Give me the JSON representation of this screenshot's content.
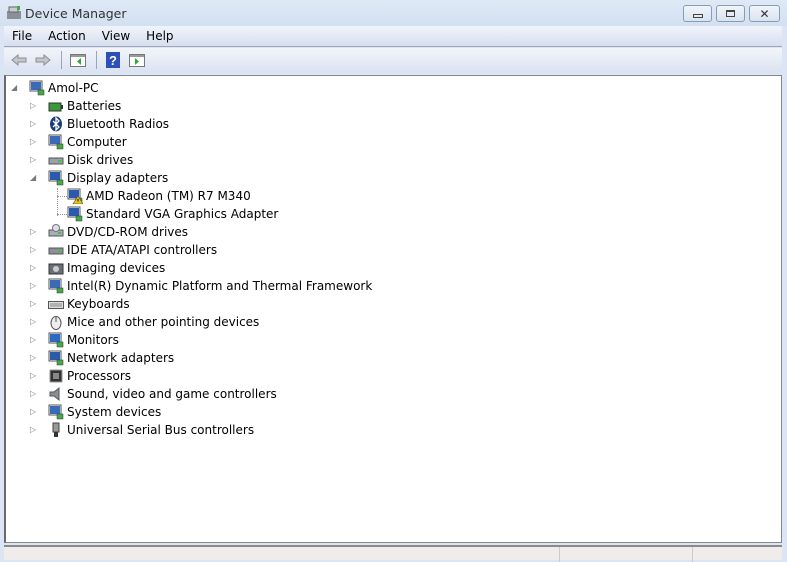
{
  "window": {
    "title": "Device Manager",
    "minimize": "minimize",
    "maximize": "maximize",
    "close": "close"
  },
  "menu": [
    "File",
    "Action",
    "View",
    "Help"
  ],
  "toolbar": [
    "back-icon",
    "forward-icon",
    "show-hide-console-tree-icon",
    "help-icon",
    "show-action-pane-icon"
  ],
  "tree": {
    "root": "Amol-PC",
    "categories": [
      {
        "label": "Batteries",
        "icon": "battery-icon"
      },
      {
        "label": "Bluetooth Radios",
        "icon": "bluetooth-icon"
      },
      {
        "label": "Computer",
        "icon": "computer-icon"
      },
      {
        "label": "Disk drives",
        "icon": "disk-drive-icon"
      },
      {
        "label": "Display adapters",
        "icon": "display-adapter-icon",
        "expanded": true,
        "children": [
          {
            "label": "AMD Radeon (TM) R7 M340",
            "icon": "display-adapter-warning-icon",
            "warning": true
          },
          {
            "label": "Standard VGA Graphics Adapter",
            "icon": "display-adapter-icon"
          }
        ]
      },
      {
        "label": "DVD/CD-ROM drives",
        "icon": "dvd-drive-icon"
      },
      {
        "label": "IDE ATA/ATAPI controllers",
        "icon": "ide-controller-icon"
      },
      {
        "label": "Imaging devices",
        "icon": "camera-icon"
      },
      {
        "label": "Intel(R) Dynamic Platform and Thermal Framework",
        "icon": "computer-icon"
      },
      {
        "label": "Keyboards",
        "icon": "keyboard-icon"
      },
      {
        "label": "Mice and other pointing devices",
        "icon": "mouse-icon"
      },
      {
        "label": "Monitors",
        "icon": "monitor-icon"
      },
      {
        "label": "Network adapters",
        "icon": "network-adapter-icon"
      },
      {
        "label": "Processors",
        "icon": "processor-icon"
      },
      {
        "label": "Sound, video and game controllers",
        "icon": "speaker-icon"
      },
      {
        "label": "System devices",
        "icon": "computer-icon"
      },
      {
        "label": "Universal Serial Bus controllers",
        "icon": "usb-icon"
      }
    ]
  }
}
